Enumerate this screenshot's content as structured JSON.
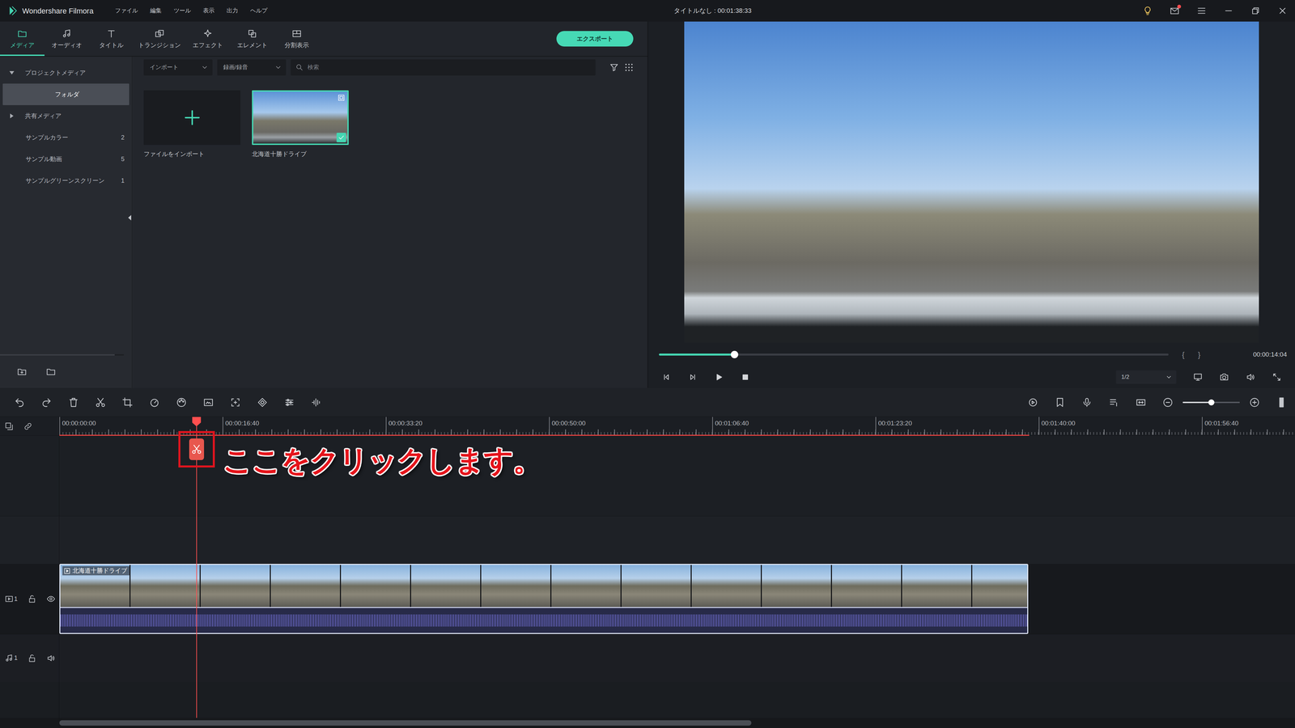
{
  "window": {
    "app_name": "Wondershare Filmora",
    "title": "タイトルなし : 00:01:38:33",
    "menus": [
      "ファイル",
      "編集",
      "ツール",
      "表示",
      "出力",
      "ヘルプ"
    ],
    "notification": true
  },
  "tabs": [
    {
      "label": "メディア",
      "selected": true
    },
    {
      "label": "オーディオ",
      "selected": false
    },
    {
      "label": "タイトル",
      "selected": false
    },
    {
      "label": "トランジション",
      "selected": false
    },
    {
      "label": "エフェクト",
      "selected": false
    },
    {
      "label": "エレメント",
      "selected": false
    },
    {
      "label": "分割表示",
      "selected": false
    }
  ],
  "export_button": "エクスポート",
  "sidebar": {
    "items": [
      {
        "label": "プロジェクトメディア",
        "kind": "group",
        "expanded": true,
        "selected": false
      },
      {
        "label": "フォルダ",
        "kind": "folder",
        "selected": true
      },
      {
        "label": "共有メディア",
        "kind": "group",
        "expanded": false,
        "selected": false
      },
      {
        "label": "サンプルカラー",
        "kind": "item",
        "count": "2",
        "selected": false
      },
      {
        "label": "サンプル動画",
        "kind": "item",
        "count": "5",
        "selected": false
      },
      {
        "label": "サンプルグリーンスクリーン",
        "kind": "item",
        "count": "1",
        "selected": false
      }
    ]
  },
  "library": {
    "import_menu": "インポート",
    "record_menu": "録画/録音",
    "search": {
      "placeholder": "検索"
    },
    "items": [
      {
        "label": "ファイルをインポート",
        "kind": "import",
        "selected": false,
        "in_timeline": false
      },
      {
        "label": "北海道十勝ドライブ",
        "kind": "clip",
        "selected": true,
        "in_timeline": true
      }
    ]
  },
  "preview": {
    "level": 0.148,
    "mark_in": "{",
    "mark_out": "}",
    "time": "00:00:14:04",
    "quality": "1/2"
  },
  "timeline": {
    "zoom": {
      "level": 0.5
    },
    "ruler": [
      "00:00:00:00",
      "00:00:16:40",
      "00:00:33:20",
      "00:00:50:00",
      "00:01:06:40",
      "00:01:23:20",
      "00:01:40:00",
      "00:01:56:40"
    ],
    "render": {
      "level": 0.785
    },
    "playhead": {
      "level": 0.111
    },
    "tracks": [
      {
        "kind": "video",
        "number": "1",
        "locked": false,
        "visible": true,
        "clip": {
          "label": "北海道十勝ドライブ",
          "level": 0.784,
          "selected": true
        }
      },
      {
        "kind": "audio",
        "number": "1",
        "locked": false,
        "muted": false
      }
    ],
    "scrollbar": {
      "level": 0.56
    }
  },
  "annotation": {
    "text": "ここをクリックします。"
  }
}
